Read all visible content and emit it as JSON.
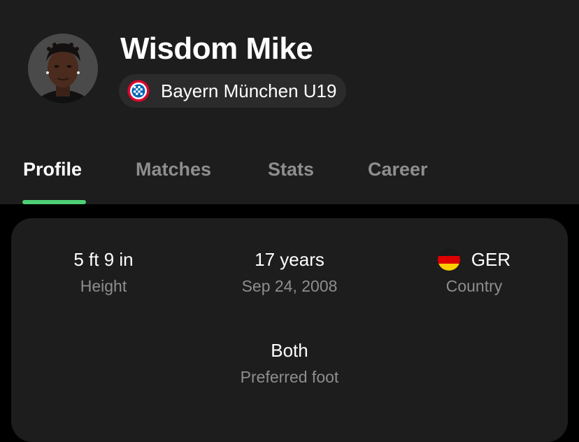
{
  "player": {
    "name": "Wisdom Mike",
    "team": "Bayern München U19"
  },
  "tabs": [
    {
      "label": "Profile",
      "active": true
    },
    {
      "label": "Matches",
      "active": false
    },
    {
      "label": "Stats",
      "active": false
    },
    {
      "label": "Career",
      "active": false
    }
  ],
  "profile": {
    "height": {
      "value": "5 ft 9 in",
      "label": "Height"
    },
    "age": {
      "value": "17 years",
      "label": "Sep 24, 2008"
    },
    "country": {
      "value": "GER",
      "label": "Country",
      "flag_icon": "germany-flag-icon"
    },
    "foot": {
      "value": "Both",
      "label": "Preferred foot"
    }
  },
  "colors": {
    "accent": "#4fd077",
    "panel": "#1d1d1d",
    "muted_text": "#8e8e8e",
    "background": "#000000"
  }
}
